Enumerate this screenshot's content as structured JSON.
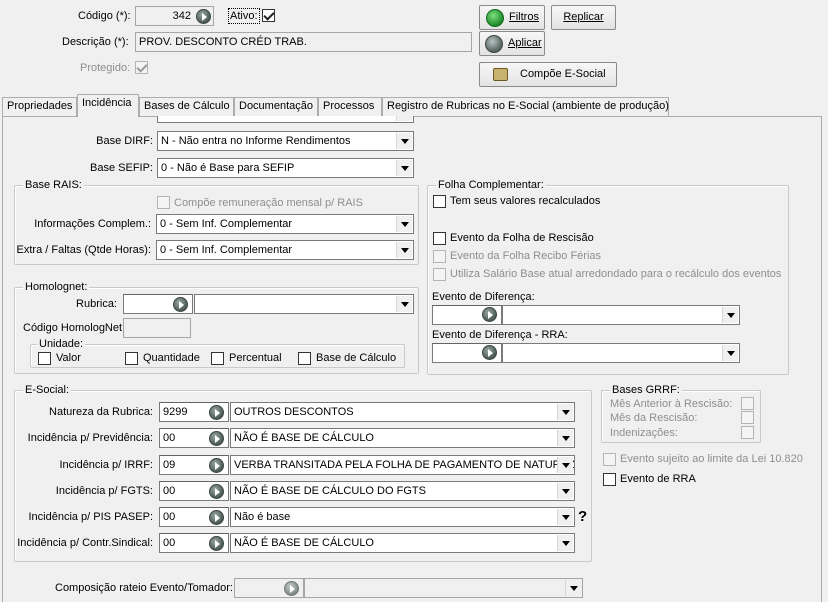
{
  "header": {
    "codigo_label": "Código (*):",
    "codigo_value": "342",
    "ativo_label": "Ativo:",
    "ativo_checked": true,
    "descricao_label": "Descrição (*):",
    "descricao_value": "PROV. DESCONTO CRÉD TRAB.",
    "protegido_label": "Protegido:",
    "protegido_checked": true,
    "buttons": {
      "filtros": "Filtros",
      "replicar": "Replicar",
      "aplicar": "Aplicar",
      "compoe": "Compõe E-Social"
    }
  },
  "tabs": [
    {
      "label": "Propriedades",
      "active": false
    },
    {
      "label": "Incidência",
      "active": true
    },
    {
      "label": "Bases de Cálculo",
      "active": false
    },
    {
      "label": "Documentação",
      "active": false
    },
    {
      "label": "Processos",
      "active": false
    },
    {
      "label": "Registro de Rubricas no E-Social (ambiente de produção)",
      "active": false
    }
  ],
  "base_dirf": {
    "label": "Base DIRF:",
    "value": "N - Não entra no Informe Rendimentos"
  },
  "base_sefip": {
    "label": "Base SEFIP:",
    "value": "0 - Não é Base para SEFIP"
  },
  "base_rais": {
    "title": "Base RAIS:",
    "compoe_label": "Compõe remuneração mensal p/ RAIS",
    "info_label": "Informações Complem.:",
    "info_value": "0 - Sem Inf. Complementar",
    "extra_label": "Extra / Faltas (Qtde Horas):",
    "extra_value": "0 - Sem Inf. Complementar"
  },
  "folha_complementar": {
    "title": "Folha Complementar:",
    "recalc_label": "Tem seus valores recalculados",
    "rescisao_label": "Evento da Folha de Rescisão",
    "ferias_label": "Evento da Folha Recibo Férias",
    "salario_label": "Utiliza Salário Base atual arredondado para o recálculo dos eventos",
    "diferenca_label": "Evento de Diferença:",
    "diferenca_rra_label": "Evento de Diferença - RRA:"
  },
  "homolognet": {
    "title": "Homolognet:",
    "rubrica_label": "Rubrica:",
    "codigo_label": "Código HomologNet",
    "unidade_title": "Unidade:",
    "units": [
      "Valor",
      "Quantidade",
      "Percentual",
      "Base de Cálculo"
    ]
  },
  "esocial": {
    "title": "E-Social:",
    "rows": [
      {
        "label": "Natureza da Rubrica:",
        "code": "9299",
        "value": "OUTROS DESCONTOS"
      },
      {
        "label": "Incidência p/ Previdência:",
        "code": "00",
        "value": "NÃO É BASE DE CÁLCULO"
      },
      {
        "label": "Incidência p/ IRRF:",
        "code": "09",
        "value": "VERBA TRANSITADA PELA FOLHA DE PAGAMENTO DE NATUREZ"
      },
      {
        "label": "Incidência p/ FGTS:",
        "code": "00",
        "value": "NÃO É BASE DE CÁLCULO DO FGTS"
      },
      {
        "label": "Incidência p/ PIS PASEP:",
        "code": "00",
        "value": "Não é base"
      },
      {
        "label": "Incidência p/ Contr.Sindical:",
        "code": "00",
        "value": "NÃO É BASE DE CÁLCULO"
      }
    ],
    "help_mark": "?"
  },
  "bases_grrf": {
    "title": "Bases GRRF:",
    "items": [
      "Mês Anterior à Rescisão:",
      "Mês da Rescisão:",
      "Indenizações:"
    ]
  },
  "evento_lei_label": "Evento sujeito ao limite da Lei 10.820",
  "evento_rra_label": "Evento de RRA",
  "composicao_label": "Composição rateio Evento/Tomador:"
}
